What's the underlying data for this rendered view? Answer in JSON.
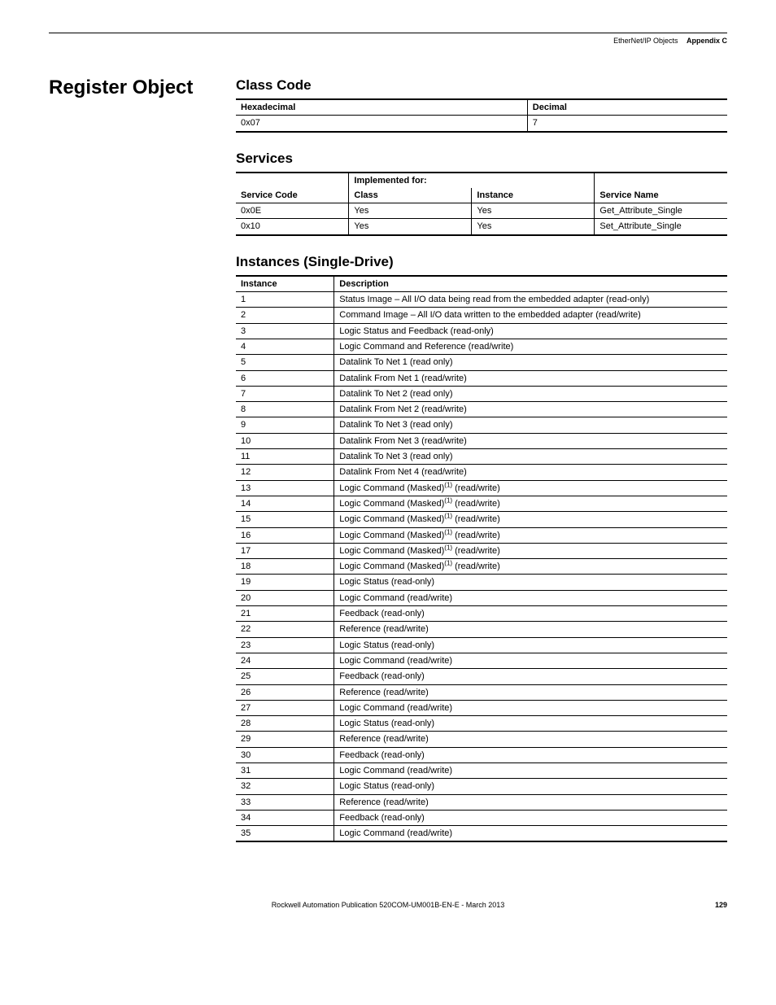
{
  "header": {
    "subject": "EtherNet/IP Objects",
    "appendix": "Appendix C"
  },
  "section_title": "Register Object",
  "classcode": {
    "heading": "Class Code",
    "cols": [
      "Hexadecimal",
      "Decimal"
    ],
    "rows": [
      {
        "hex": "0x07",
        "dec": "7"
      }
    ]
  },
  "services": {
    "heading": "Services",
    "impl_label": "Implemented for:",
    "cols": [
      "Service Code",
      "Class",
      "Instance",
      "Service Name"
    ],
    "rows": [
      {
        "code": "0x0E",
        "cls": "Yes",
        "ins": "Yes",
        "name": "Get_Attribute_Single"
      },
      {
        "code": "0x10",
        "cls": "Yes",
        "ins": "Yes",
        "name": "Set_Attribute_Single"
      }
    ]
  },
  "instances": {
    "heading": "Instances (Single-Drive)",
    "cols": [
      "Instance",
      "Description"
    ],
    "rows": [
      {
        "n": "1",
        "d": "Status Image – All I/O data being read from the embedded adapter (read-only)"
      },
      {
        "n": "2",
        "d": "Command Image – All I/O data written to the embedded adapter (read/write)"
      },
      {
        "n": "3",
        "d": "Logic Status and Feedback (read-only)"
      },
      {
        "n": "4",
        "d": "Logic Command and Reference (read/write)"
      },
      {
        "n": "5",
        "d": "Datalink To Net 1 (read only)"
      },
      {
        "n": "6",
        "d": "Datalink From Net 1 (read/write)"
      },
      {
        "n": "7",
        "d": "Datalink To Net 2 (read only)"
      },
      {
        "n": "8",
        "d": "Datalink From Net 2 (read/write)"
      },
      {
        "n": "9",
        "d": "Datalink To Net 3 (read only)"
      },
      {
        "n": "10",
        "d": "Datalink From Net 3 (read/write)"
      },
      {
        "n": "11",
        "d": "Datalink To Net 3 (read only)"
      },
      {
        "n": "12",
        "d": "Datalink From Net 4 (read/write)"
      },
      {
        "n": "13",
        "d": "Logic Command (Masked)",
        "sup": "(1)",
        "tail": " (read/write)"
      },
      {
        "n": "14",
        "d": "Logic Command (Masked)",
        "sup": "(1)",
        "tail": " (read/write)"
      },
      {
        "n": "15",
        "d": "Logic Command (Masked)",
        "sup": "(1)",
        "tail": " (read/write)"
      },
      {
        "n": "16",
        "d": "Logic Command (Masked)",
        "sup": "(1)",
        "tail": " (read/write)"
      },
      {
        "n": "17",
        "d": "Logic Command (Masked)",
        "sup": "(1)",
        "tail": " (read/write)"
      },
      {
        "n": "18",
        "d": "Logic Command (Masked)",
        "sup": "(1)",
        "tail": " (read/write)"
      },
      {
        "n": "19",
        "d": "Logic Status (read-only)"
      },
      {
        "n": "20",
        "d": "Logic Command (read/write)"
      },
      {
        "n": "21",
        "d": "Feedback (read-only)"
      },
      {
        "n": "22",
        "d": "Reference (read/write)"
      },
      {
        "n": "23",
        "d": "Logic Status (read-only)"
      },
      {
        "n": "24",
        "d": "Logic Command (read/write)"
      },
      {
        "n": "25",
        "d": "Feedback (read-only)"
      },
      {
        "n": "26",
        "d": "Reference (read/write)"
      },
      {
        "n": "27",
        "d": "Logic Command (read/write)"
      },
      {
        "n": "28",
        "d": "Logic Status (read-only)"
      },
      {
        "n": "29",
        "d": "Reference (read/write)"
      },
      {
        "n": "30",
        "d": "Feedback (read-only)"
      },
      {
        "n": "31",
        "d": "Logic Command (read/write)"
      },
      {
        "n": "32",
        "d": "Logic Status (read-only)"
      },
      {
        "n": "33",
        "d": "Reference (read/write)"
      },
      {
        "n": "34",
        "d": "Feedback (read-only)"
      },
      {
        "n": "35",
        "d": "Logic Command (read/write)"
      }
    ]
  },
  "footer": {
    "pub": "Rockwell Automation Publication 520COM-UM001B-EN-E - March 2013",
    "page": "129"
  }
}
